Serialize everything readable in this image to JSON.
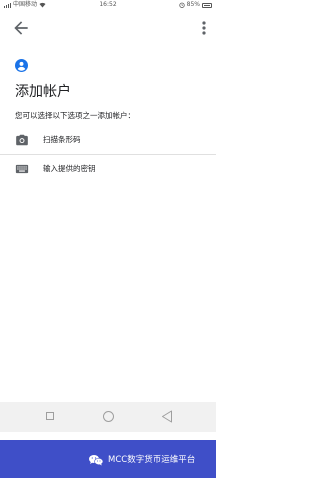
{
  "status_bar": {
    "carrier": "中国移动",
    "time": "16:52",
    "battery": "85%"
  },
  "header": {
    "title": "添加帐户",
    "subtitle": "您可以选择以下选项之一添加帐户："
  },
  "options": [
    {
      "label": "扫描条形码",
      "icon": "camera-icon"
    },
    {
      "label": "输入提供的密钥",
      "icon": "keyboard-icon"
    }
  ],
  "banner": {
    "text": "MCC数字货币运维平台"
  },
  "colors": {
    "accent": "#1a73e8",
    "banner": "#3f4fc8",
    "nav_bar": "#f1f1f1"
  }
}
